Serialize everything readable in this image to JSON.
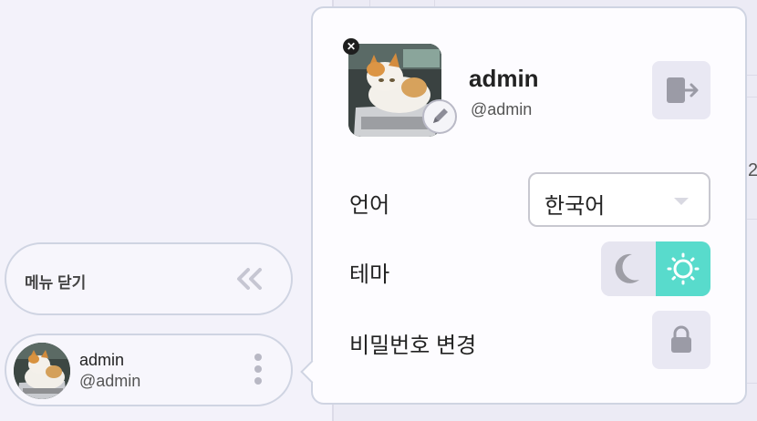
{
  "sidebar": {
    "collapse_label": "메뉴 닫기",
    "user": {
      "name": "admin",
      "handle": "@admin"
    }
  },
  "popover": {
    "name": "admin",
    "handle": "@admin",
    "language_label": "언어",
    "language_value": "한국어",
    "theme_label": "테마",
    "theme_selected": "light",
    "password_label": "비밀번호 변경"
  },
  "background": {
    "fragment_text": "2"
  },
  "colors": {
    "accent_theme": "#58dbcc",
    "button_bg": "#e9e8f3",
    "border": "#cfd4e2"
  },
  "icons": {
    "collapse": "double-chevron-left-icon",
    "kebab": "kebab-menu-icon",
    "remove": "close-icon",
    "edit": "pencil-icon",
    "logout": "logout-icon",
    "caret": "caret-down-icon",
    "dark": "moon-icon",
    "light": "sun-icon",
    "password": "lock-icon"
  }
}
